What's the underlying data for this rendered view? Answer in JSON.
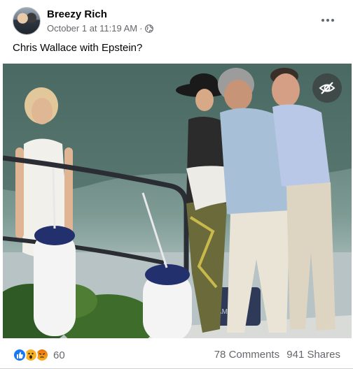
{
  "post": {
    "author": "Breezy Rich",
    "timestamp": "October 1 at 11:19 AM",
    "separator": "·",
    "privacy_icon": "globe-icon",
    "more_icon": "more-options-icon",
    "caption": "Chris Wallace with Epstein?"
  },
  "photo": {
    "overlay_icon": "eye-slash-icon",
    "boat_text": "YAMAHA"
  },
  "footer": {
    "reaction_icons": [
      "like-icon",
      "wow-icon",
      "angry-icon"
    ],
    "reaction_count": "60",
    "comments": "78 Comments",
    "shares": "941 Shares"
  },
  "colors": {
    "like": "#1877f2",
    "wow": "#f7b125",
    "angry": "#e9710f",
    "secondary_text": "#65676b"
  }
}
